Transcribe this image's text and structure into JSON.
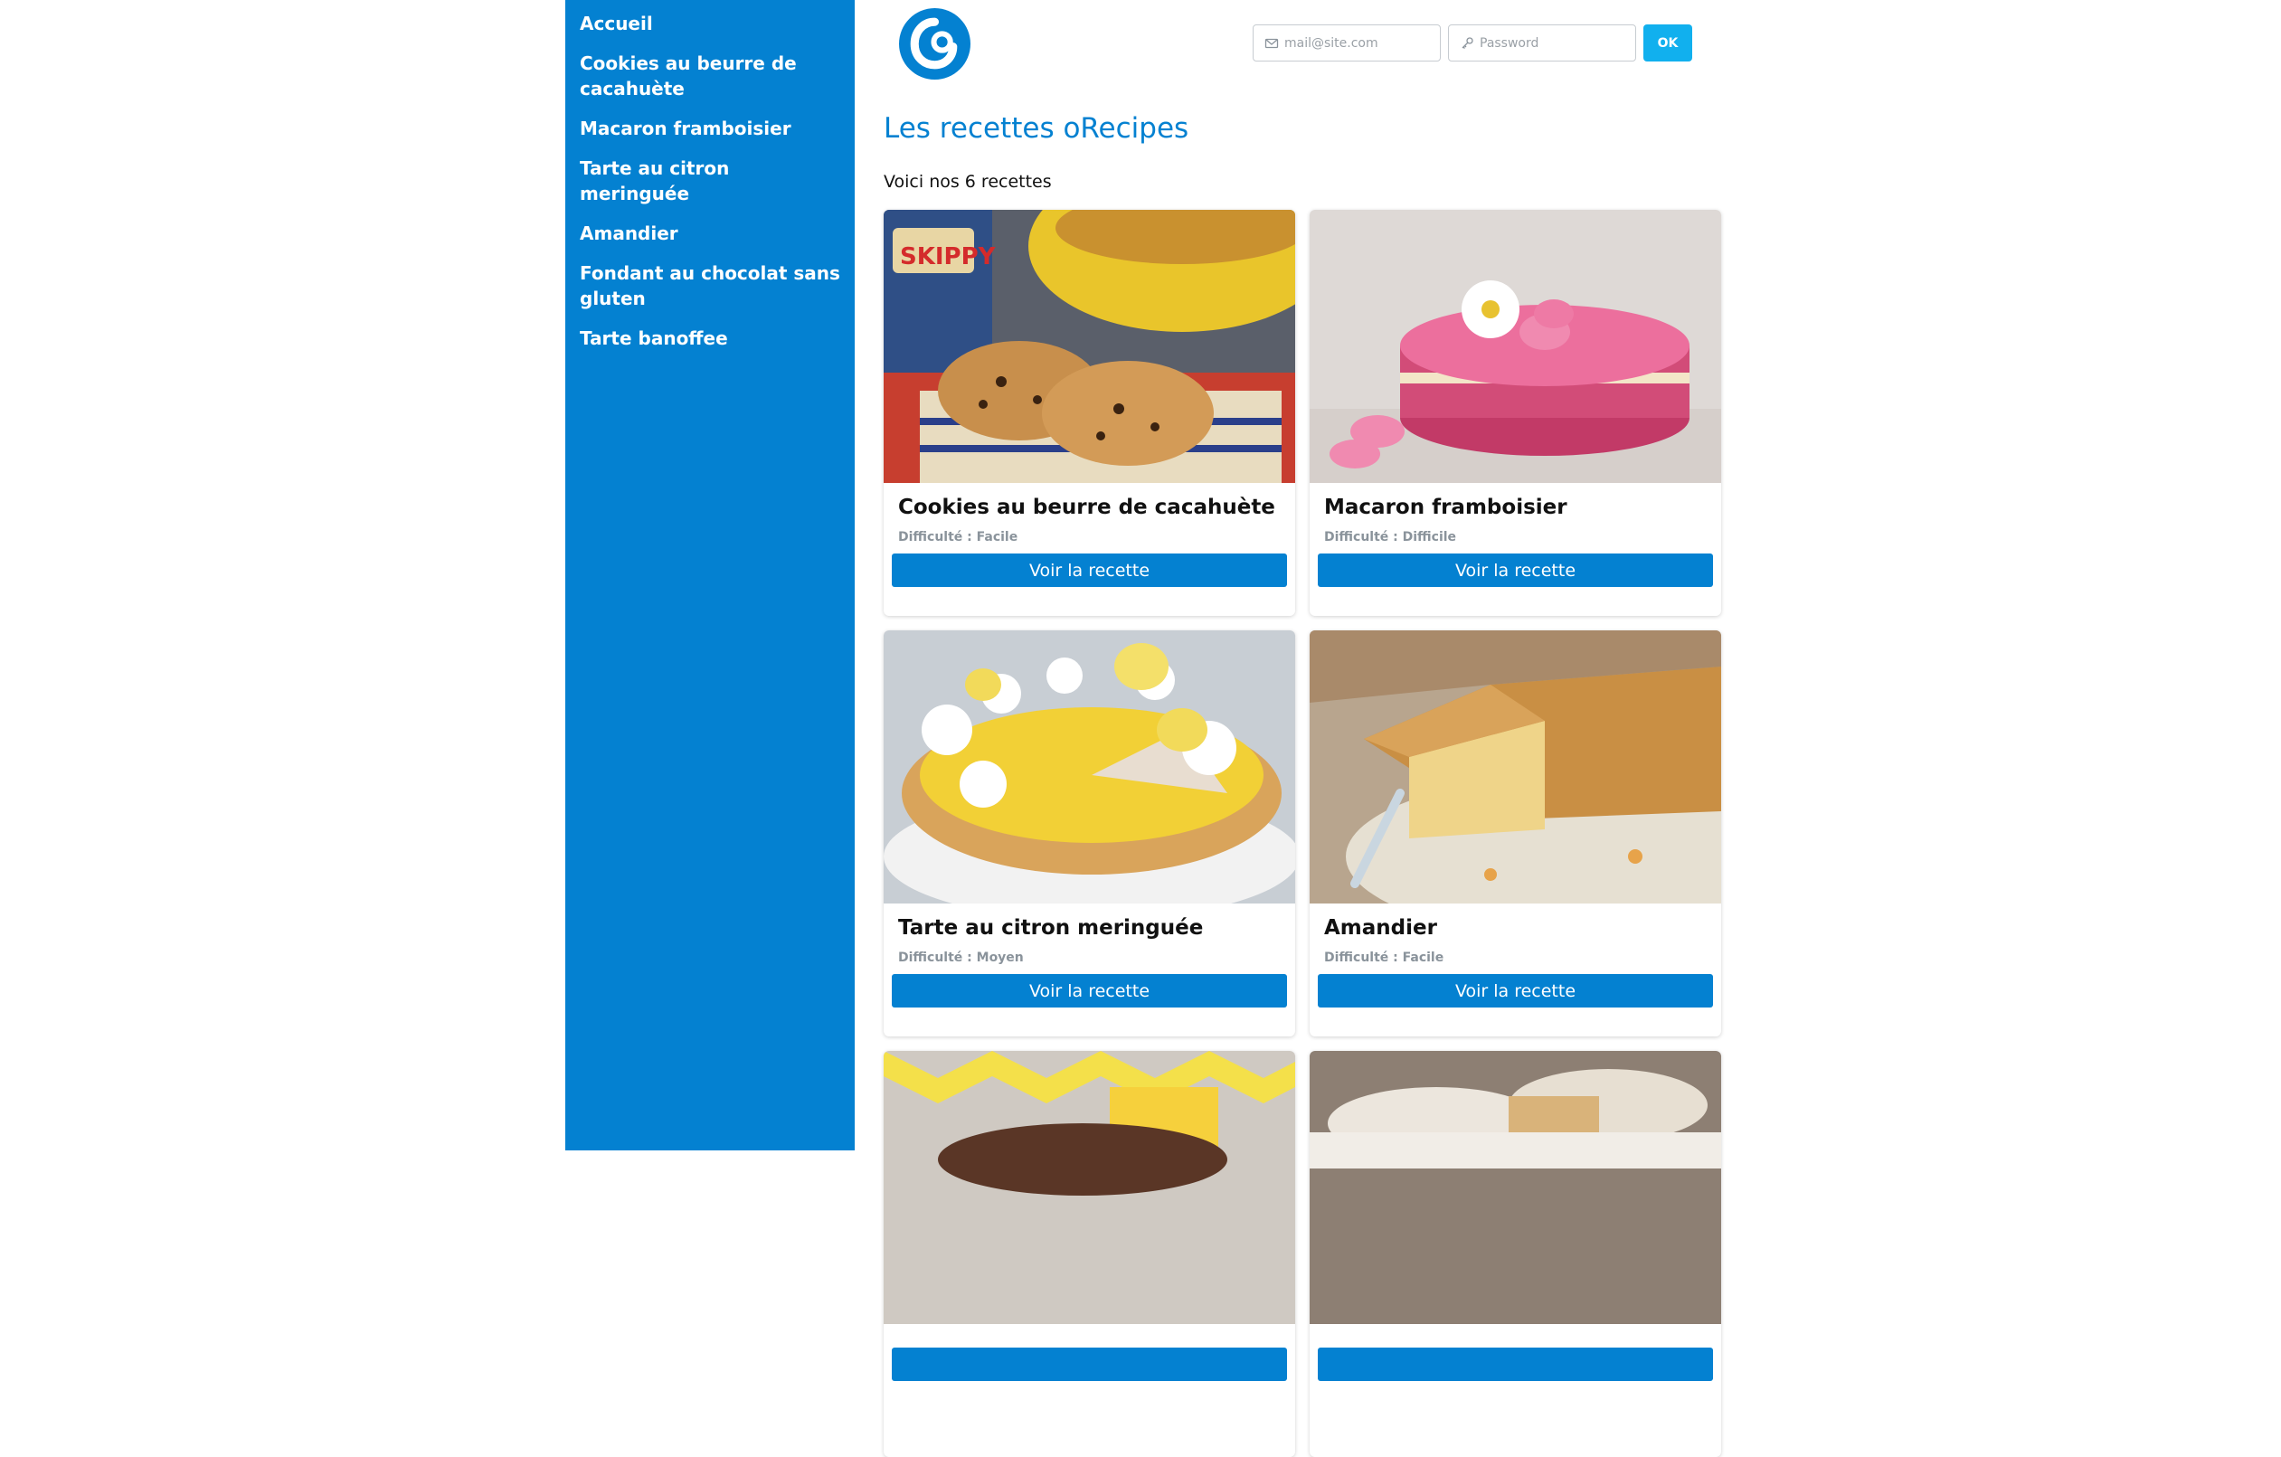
{
  "sidebar": {
    "items": [
      {
        "label": "Accueil"
      },
      {
        "label": "Cookies au beurre de cacahuète"
      },
      {
        "label": "Macaron framboisier"
      },
      {
        "label": "Tarte au citron meringuée"
      },
      {
        "label": "Amandier"
      },
      {
        "label": "Fondant au chocolat sans gluten"
      },
      {
        "label": "Tarte banoffee"
      }
    ]
  },
  "header": {
    "logo_icon": "orecipes-logo-icon",
    "email_placeholder": "mail@site.com",
    "password_placeholder": "Password",
    "ok_label": "OK"
  },
  "main": {
    "title": "Les recettes oRecipes",
    "subtitle": "Voici nos 6 recettes"
  },
  "recipes": [
    {
      "title": "Cookies au beurre de cacahuète",
      "difficulty": "Difficulté : Facile",
      "button": "Voir la recette"
    },
    {
      "title": "Macaron framboisier",
      "difficulty": "Difficulté : Difficile",
      "button": "Voir la recette"
    },
    {
      "title": "Tarte au citron meringuée",
      "difficulty": "Difficulté : Moyen",
      "button": "Voir la recette"
    },
    {
      "title": "Amandier",
      "difficulty": "Difficulté : Facile",
      "button": "Voir la recette"
    },
    {
      "title": "",
      "difficulty": "",
      "button": ""
    },
    {
      "title": "",
      "difficulty": "",
      "button": ""
    }
  ],
  "colors": {
    "primary": "#0481d1",
    "ok_button": "#11b0ee"
  }
}
